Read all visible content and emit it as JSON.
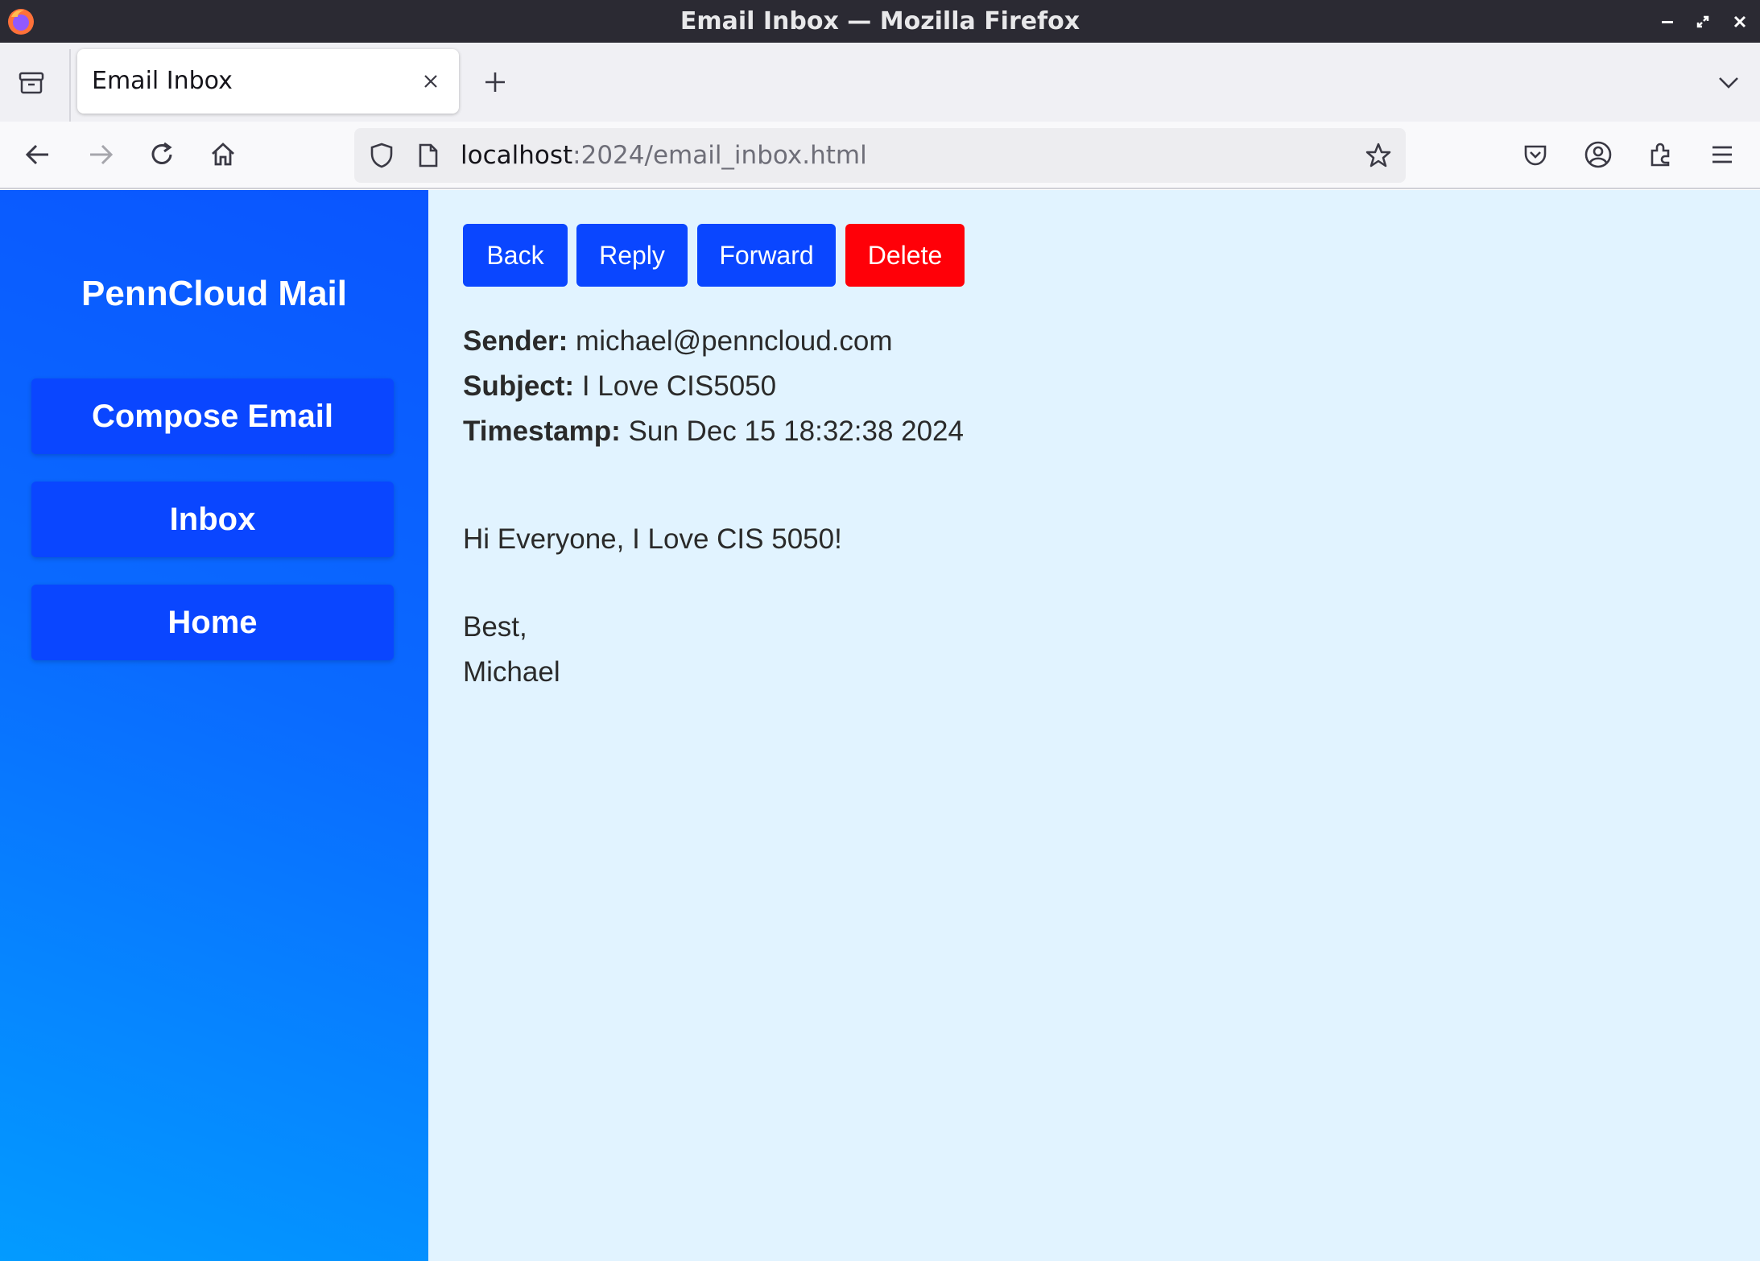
{
  "window": {
    "title": "Email Inbox — Mozilla Firefox",
    "icons": [
      "firefox-icon",
      "minimize-icon",
      "restore-icon",
      "close-icon"
    ]
  },
  "tabs": [
    {
      "label": "Email Inbox",
      "active": true
    }
  ],
  "urlbar": {
    "host": "localhost",
    "rest": ":2024/email_inbox.html"
  },
  "app": {
    "brand": "PennCloud Mail",
    "nav": {
      "compose": "Compose Email",
      "inbox": "Inbox",
      "home": "Home"
    }
  },
  "actions": {
    "back": "Back",
    "reply": "Reply",
    "forward": "Forward",
    "delete": "Delete"
  },
  "email": {
    "sender_label": "Sender:",
    "sender": "michael@penncloud.com",
    "subject_label": "Subject:",
    "subject": "I Love CIS5050",
    "timestamp_label": "Timestamp:",
    "timestamp": "Sun Dec 15 18:32:38 2024",
    "body_lines": [
      "Hi Everyone, I Love CIS 5050!",
      "Best,",
      "Michael"
    ]
  },
  "colors": {
    "primary": "#0a46ff",
    "danger": "#ff0008",
    "main_bg": "#e1f3ff",
    "sidebar_gradient_top": "#0a55ff",
    "sidebar_gradient_bottom": "#039bff"
  }
}
